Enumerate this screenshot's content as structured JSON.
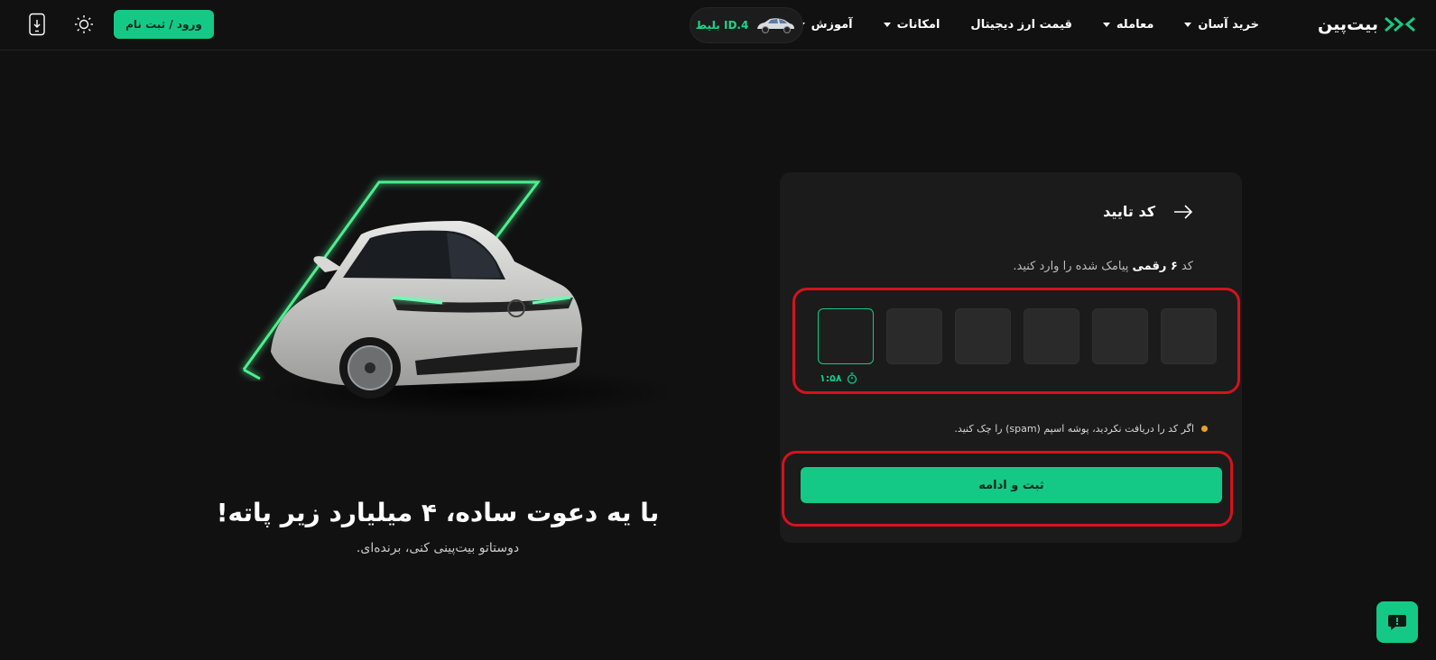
{
  "header": {
    "logo_text": "بیت‌پین",
    "nav": [
      {
        "label": "خرید آسان",
        "has_dropdown": true
      },
      {
        "label": "معامله",
        "has_dropdown": true
      },
      {
        "label": "قیمت ارز دیجیتال",
        "has_dropdown": false
      },
      {
        "label": "امکانات",
        "has_dropdown": true
      },
      {
        "label": "آموزش",
        "has_dropdown": true
      }
    ],
    "ticket_label": "بلیط ID.4",
    "login_label": "ورود / ثبت نام",
    "icons": [
      "theme-toggle-icon",
      "app-download-icon"
    ]
  },
  "hero": {
    "title": "با یه دعوت ساده، ۴ میلیارد زیر پاته!",
    "subtitle": "دوستاتو بیت‌پینی کنی، برنده‌ای."
  },
  "card": {
    "title": "کد تایید",
    "desc_prefix": "کد",
    "desc_bold": "۶ رقمی",
    "desc_suffix": "پیامک شده را وارد کنید.",
    "otp_digits": [
      "",
      "",
      "",
      "",
      "",
      ""
    ],
    "timer": "۱:۵۸",
    "hint": "اگر کد را دریافت نکردید، پوشه اسپم (spam) را چک کنید.",
    "submit_label": "ثبت و ادامه"
  },
  "colors": {
    "accent": "#14c985",
    "background": "#111111",
    "card": "#1b1b1b",
    "annotation_red": "#d3131d",
    "hint_dot": "#e6a323"
  }
}
